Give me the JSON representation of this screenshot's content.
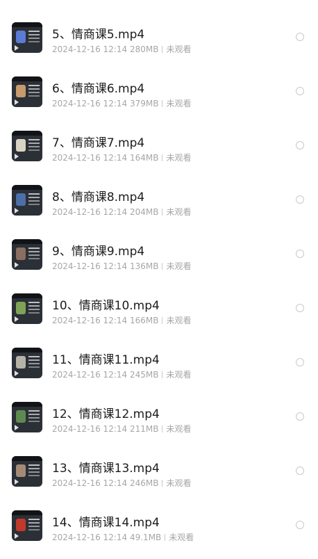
{
  "files": [
    {
      "name": "5、情商课5.mp4",
      "date": "2024-12-16 12:14",
      "size": "280MB",
      "status": "未观看",
      "accent": "#5a7bd6"
    },
    {
      "name": "6、情商课6.mp4",
      "date": "2024-12-16 12:14",
      "size": "379MB",
      "status": "未观看",
      "accent": "#c79b6b"
    },
    {
      "name": "7、情商课7.mp4",
      "date": "2024-12-16 12:14",
      "size": "164MB",
      "status": "未观看",
      "accent": "#d9d3c4"
    },
    {
      "name": "8、情商课8.mp4",
      "date": "2024-12-16 12:14",
      "size": "204MB",
      "status": "未观看",
      "accent": "#4c6fa8"
    },
    {
      "name": "9、情商课9.mp4",
      "date": "2024-12-16 12:14",
      "size": "136MB",
      "status": "未观看",
      "accent": "#8a6e62"
    },
    {
      "name": "10、情商课10.mp4",
      "date": "2024-12-16 12:14",
      "size": "166MB",
      "status": "未观看",
      "accent": "#7fa356"
    },
    {
      "name": "11、情商课11.mp4",
      "date": "2024-12-16 12:14",
      "size": "245MB",
      "status": "未观看",
      "accent": "#b7b2a8"
    },
    {
      "name": "12、情商课12.mp4",
      "date": "2024-12-16 12:14",
      "size": "211MB",
      "status": "未观看",
      "accent": "#5e8a52"
    },
    {
      "name": "13、情商课13.mp4",
      "date": "2024-12-16 12:14",
      "size": "246MB",
      "status": "未观看",
      "accent": "#a58b76"
    },
    {
      "name": "14、情商课14.mp4",
      "date": "2024-12-16 12:14",
      "size": "49.1MB",
      "status": "未观看",
      "accent": "#c0392b"
    }
  ]
}
